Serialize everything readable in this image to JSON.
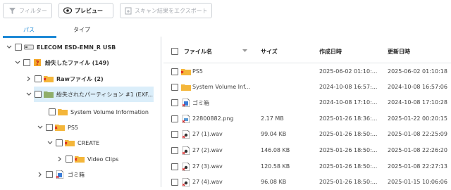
{
  "toolbar": {
    "filter_label": "フィルター",
    "preview_label": "プレビュー",
    "export_label": "スキャン結果をエクスポート"
  },
  "tabs": {
    "path": "パス",
    "type": "タイプ"
  },
  "tree": {
    "drive": "ELECOM ESD-EMN_R USB",
    "lost_files": "紛失したファイル (149)",
    "raw_files": "Rawファイル (2)",
    "lost_partition": "紛失されたパーティション #1 (EXF...",
    "system_volume": "System Volume Information",
    "ps5": "PS5",
    "create": "CREATE",
    "video_clips": "Video Clips",
    "trash": "ゴミ箱"
  },
  "list": {
    "headers": {
      "name": "ファイル名",
      "size": "サイズ",
      "created": "作成日時",
      "modified": "更新日時"
    },
    "rows": [
      {
        "name": "PS5",
        "size": "",
        "created": "2025-06-02 01:10:...",
        "modified": "2025-06-02 01:10:18",
        "icon": "folder-lost-icon"
      },
      {
        "name": "System Volume Inf...",
        "size": "",
        "created": "2024-10-08 16:57:...",
        "modified": "2024-10-08 16:57:06",
        "icon": "folder-icon"
      },
      {
        "name": "ゴミ箱",
        "size": "",
        "created": "2024-10-08 17:10:...",
        "modified": "2024-10-08 17:10:28",
        "icon": "trash-file-icon"
      },
      {
        "name": "22800882.png",
        "size": "2.17 MB",
        "created": "2025-01-26 18:36:...",
        "modified": "2025-01-22 00:20:15",
        "icon": "png-file-icon"
      },
      {
        "name": "27 (1).wav",
        "size": "99.04 KB",
        "created": "2025-01-26 18:50:...",
        "modified": "2025-01-08 22:25:09",
        "icon": "wav-file-icon"
      },
      {
        "name": "27 (2).wav",
        "size": "146.08 KB",
        "created": "2025-01-26 18:50:...",
        "modified": "2025-01-08 22:26:20",
        "icon": "wav-file-icon"
      },
      {
        "name": "27 (3).wav",
        "size": "120.58 KB",
        "created": "2025-01-26 18:50:...",
        "modified": "2025-01-08 22:27:13",
        "icon": "wav-file-icon"
      },
      {
        "name": "27 (4).wav",
        "size": "96.08 KB",
        "created": "2025-01-26 18:50:...",
        "modified": "2025-01-15 10:06:06",
        "icon": "wav-file-icon"
      }
    ]
  }
}
